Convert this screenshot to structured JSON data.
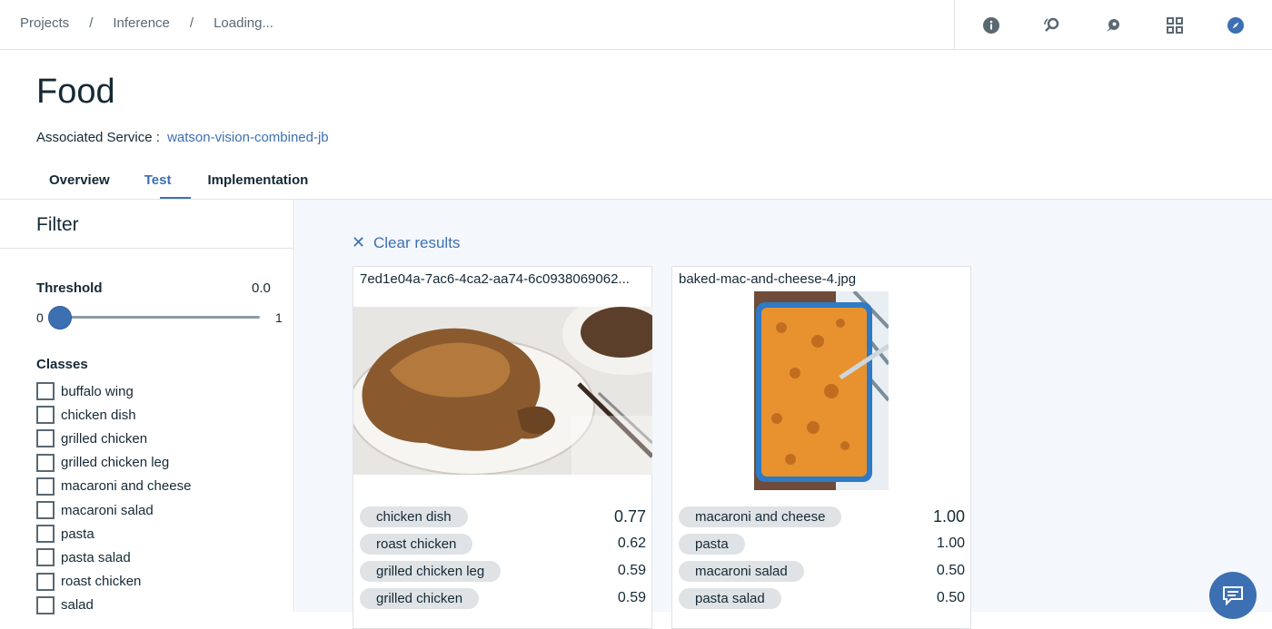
{
  "breadcrumb": {
    "items": [
      "Projects",
      "Inference",
      "Loading..."
    ],
    "separator": "/"
  },
  "toolbar": {
    "icons": [
      "info-icon",
      "search-recycle-icon",
      "rocket-icon",
      "apps-icon",
      "compass-icon"
    ]
  },
  "header": {
    "title": "Food",
    "service_label": "Associated Service :",
    "service_link": "watson-vision-combined-jb"
  },
  "tabs": [
    {
      "label": "Overview",
      "active": false
    },
    {
      "label": "Test",
      "active": true
    },
    {
      "label": "Implementation",
      "active": false
    }
  ],
  "sidebar": {
    "filter_title": "Filter",
    "threshold_label": "Threshold",
    "threshold_value": "0.0",
    "slider_min": "0",
    "slider_max": "1",
    "slider_fraction": 0.0,
    "classes_label": "Classes",
    "classes": [
      "buffalo wing",
      "chicken dish",
      "grilled chicken",
      "grilled chicken leg",
      "macaroni and cheese",
      "macaroni salad",
      "pasta",
      "pasta salad",
      "roast chicken",
      "salad"
    ]
  },
  "main": {
    "clear_label": "Clear results",
    "cards": [
      {
        "filename": "7ed1e04a-7ac6-4ca2-aa74-6c0938069062...",
        "image": "roast-chicken-photo",
        "results": [
          {
            "label": "chicken dish",
            "score": "0.77"
          },
          {
            "label": "roast chicken",
            "score": "0.62"
          },
          {
            "label": "grilled chicken leg",
            "score": "0.59"
          },
          {
            "label": "grilled chicken",
            "score": "0.59"
          }
        ]
      },
      {
        "filename": "baked-mac-and-cheese-4.jpg",
        "image": "mac-and-cheese-photo",
        "results": [
          {
            "label": "macaroni and cheese",
            "score": "1.00"
          },
          {
            "label": "pasta",
            "score": "1.00"
          },
          {
            "label": "macaroni salad",
            "score": "0.50"
          },
          {
            "label": "pasta salad",
            "score": "0.50"
          }
        ]
      }
    ]
  },
  "colors": {
    "accent": "#3d70b2",
    "text": "#152935",
    "panel_bg": "#f4f7fb",
    "pill_bg": "#dfe3e6"
  }
}
